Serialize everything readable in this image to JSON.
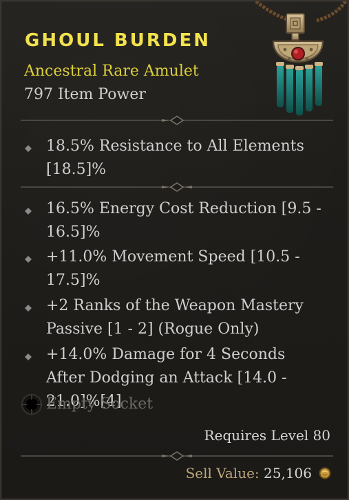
{
  "item": {
    "name": "Ghoul Burden",
    "type": "Ancestral Rare Amulet",
    "item_power": "797 Item Power",
    "implicit_affixes": [
      {
        "text": "18.5% Resistance to All Elements [18.5]%"
      }
    ],
    "affixes": [
      {
        "text": "16.5% Energy Cost Reduction [9.5 - 16.5]%"
      },
      {
        "text": "+11.0% Movement Speed [10.5 - 17.5]%"
      },
      {
        "text": "+2 Ranks of the Weapon Mastery Passive [1 - 2] (Rogue Only)"
      },
      {
        "text": "+14.0% Damage for 4 Seconds After Dodging an Attack [14.0 - 21.0]%[4]"
      }
    ],
    "socket": {
      "label": "Empty Socket"
    },
    "requirement": "Requires Level 80",
    "sell": {
      "label": "Sell Value:",
      "value": "25,106"
    }
  },
  "colors": {
    "title": "#f2e24d",
    "rare": "#dbcf3a",
    "text": "#cfcfcf",
    "muted": "#6e6b65",
    "sell_label": "#bca77c"
  },
  "icons": {
    "item": "amulet-icon",
    "bullet": "diamond-bullet-icon",
    "socket": "socket-icon",
    "currency": "gold-coin-icon"
  }
}
